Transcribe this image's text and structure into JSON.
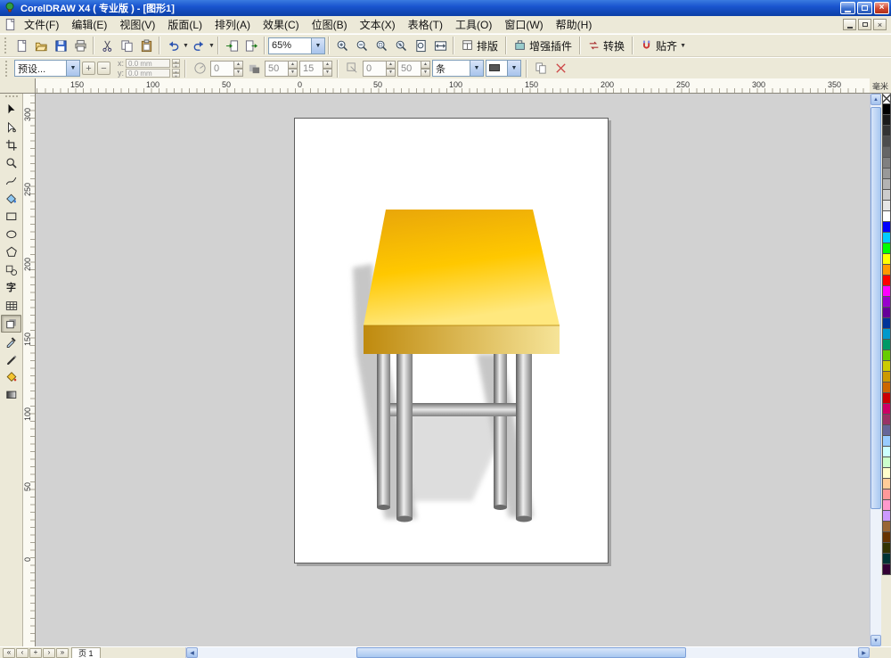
{
  "window": {
    "title": "CorelDRAW X4 ( 专业版 ) - [图形1]"
  },
  "menu": {
    "items": [
      "文件(F)",
      "编辑(E)",
      "视图(V)",
      "版面(L)",
      "排列(A)",
      "效果(C)",
      "位图(B)",
      "文本(X)",
      "表格(T)",
      "工具(O)",
      "窗口(W)",
      "帮助(H)"
    ]
  },
  "toolbar": {
    "zoom_level": "65%",
    "layout": "排版",
    "plugins": "增强插件",
    "convert": "转换",
    "snap": "贴齐"
  },
  "property_bar": {
    "preset": "预设...",
    "x_label": "x:",
    "y_label": "y:",
    "x_value": "0.0 mm",
    "y_value": "0.0 mm",
    "angle": "0",
    "opacity": "50",
    "feather": "15",
    "fade": "0",
    "stretch": "50",
    "edge": "条"
  },
  "rulers": {
    "unit": "毫米",
    "horizontal": [
      "150",
      "100",
      "50",
      "0",
      "50",
      "100",
      "150",
      "200",
      "250",
      "300",
      "350"
    ],
    "vertical": [
      "300",
      "250",
      "200",
      "150",
      "100",
      "50",
      "0"
    ]
  },
  "toolbox": {
    "tools": [
      {
        "name": "pick",
        "icon": "pick"
      },
      {
        "name": "shape",
        "icon": "shape"
      },
      {
        "name": "crop",
        "icon": "crop"
      },
      {
        "name": "zoom",
        "icon": "zoomtool"
      },
      {
        "name": "freehand",
        "icon": "freehand"
      },
      {
        "name": "smart-fill",
        "icon": "smartfill"
      },
      {
        "name": "rectangle",
        "icon": "rectangle"
      },
      {
        "name": "ellipse",
        "icon": "ellipsetool"
      },
      {
        "name": "polygon",
        "icon": "polygontool"
      },
      {
        "name": "basic-shapes",
        "icon": "basicshapes"
      },
      {
        "name": "text",
        "glyph": "字"
      },
      {
        "name": "table",
        "icon": "tabletool"
      },
      {
        "name": "interactive-drop-shadow",
        "icon": "interactive",
        "active": true
      },
      {
        "name": "eyedropper",
        "icon": "eyedropper"
      },
      {
        "name": "outline-pen",
        "icon": "outline"
      },
      {
        "name": "fill",
        "icon": "fill"
      },
      {
        "name": "interactive-fill",
        "icon": "ifill"
      }
    ]
  },
  "palette": {
    "colors": [
      "none",
      "#000000",
      "#1a1a1a",
      "#333333",
      "#4d4d4d",
      "#666666",
      "#808080",
      "#999999",
      "#b3b3b3",
      "#cccccc",
      "#e6e6e6",
      "#ffffff",
      "#0000ff",
      "#00ccff",
      "#00ff00",
      "#ffff00",
      "#ff9900",
      "#ff0000",
      "#ff00ff",
      "#9900cc",
      "#660099",
      "#003399",
      "#0099cc",
      "#009966",
      "#66cc00",
      "#cccc00",
      "#cc9900",
      "#cc6600",
      "#cc0000",
      "#cc0066",
      "#993366",
      "#666699",
      "#99ccff",
      "#ccffff",
      "#ccffcc",
      "#ffffcc",
      "#ffcc99",
      "#ff9999",
      "#ff99cc",
      "#cc99ff",
      "#996633",
      "#663300",
      "#333300",
      "#003333",
      "#330033"
    ]
  },
  "statusbar": {
    "page_tab": "页 1"
  },
  "drawing": {
    "subject": "stool",
    "top_dark": "#e8a50a",
    "top_mid": "#ffc800",
    "top_light": "#ffe87e",
    "front_dark": "#bf8a0e",
    "front_light": "#f6e498",
    "leg_dark": "#5e5e5e",
    "leg_light": "#efefef",
    "leg_edge": "#7d7d7d",
    "shadow": "#8f8f8f"
  }
}
